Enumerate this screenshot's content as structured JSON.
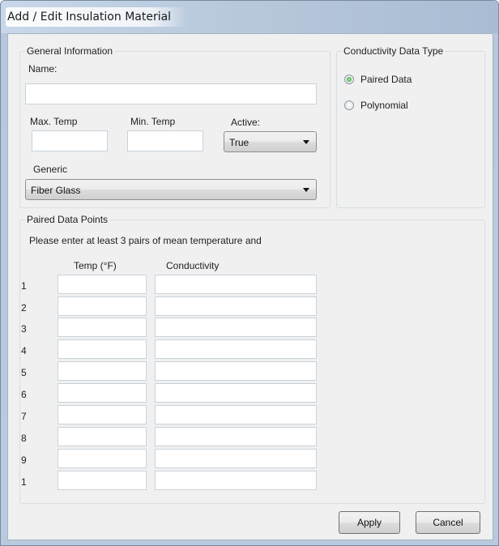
{
  "window": {
    "title": "Add / Edit Insulation Material"
  },
  "general": {
    "group_label": "General Information",
    "name_label": "Name:",
    "name_value": "",
    "max_temp_label": "Max. Temp",
    "max_temp_value": "",
    "min_temp_label": "Min. Temp",
    "min_temp_value": "",
    "active_label": "Active:",
    "active_value": "True",
    "generic_label": "Generic",
    "generic_value": "Fiber Glass"
  },
  "conductivity_type": {
    "group_label": "Conductivity Data Type",
    "options": [
      {
        "label": "Paired Data",
        "selected": true
      },
      {
        "label": "Polynomial",
        "selected": false
      }
    ]
  },
  "paired": {
    "group_label": "Paired Data Points",
    "instructions": "Please enter at least 3 pairs of mean temperature and",
    "col_temp": "Temp (°F)",
    "col_conductivity": "Conductivity",
    "rows": [
      {
        "num": "1",
        "temp": "",
        "conductivity": ""
      },
      {
        "num": "2",
        "temp": "",
        "conductivity": ""
      },
      {
        "num": "3",
        "temp": "",
        "conductivity": ""
      },
      {
        "num": "4",
        "temp": "",
        "conductivity": ""
      },
      {
        "num": "5",
        "temp": "",
        "conductivity": ""
      },
      {
        "num": "6",
        "temp": "",
        "conductivity": ""
      },
      {
        "num": "7",
        "temp": "",
        "conductivity": ""
      },
      {
        "num": "8",
        "temp": "",
        "conductivity": ""
      },
      {
        "num": "9",
        "temp": "",
        "conductivity": ""
      },
      {
        "num": "1",
        "temp": "",
        "conductivity": ""
      }
    ]
  },
  "buttons": {
    "apply": "Apply",
    "cancel": "Cancel"
  }
}
